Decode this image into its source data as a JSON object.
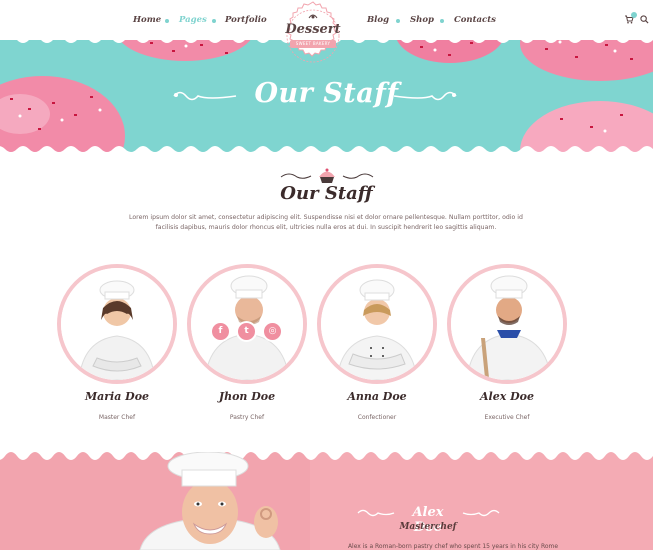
{
  "nav": {
    "items": [
      {
        "label": "Home",
        "active": false
      },
      {
        "label": "Pages",
        "active": true
      },
      {
        "label": "Portfolio",
        "active": false
      },
      {
        "label": "Blog",
        "active": false
      },
      {
        "label": "Shop",
        "active": false
      },
      {
        "label": "Contacts",
        "active": false
      }
    ],
    "logo": {
      "name": "Dessert",
      "tagline": "SWEET BAKERY"
    },
    "cart_icon": "cart-icon",
    "search_icon": "search-icon"
  },
  "hero": {
    "title": "Our Staff"
  },
  "staff": {
    "title": "Our Staff",
    "intro": "Lorem ipsum dolor sit amet, consectetur adipiscing elit. Suspendisse nisi et dolor ornare pellentesque. Nullam porttitor, odio id facilisis dapibus, mauris dolor rhoncus elit, ultricies nulla eros at dui. In suscipit hendrerit leo sagittis aliquam.",
    "members": [
      {
        "name": "Maria Doe",
        "role": "Master Chef"
      },
      {
        "name": "Jhon Doe",
        "role": "Pastry Chef"
      },
      {
        "name": "Anna Doe",
        "role": "Confectioner"
      },
      {
        "name": "Alex Doe",
        "role": "Executive Chef"
      }
    ],
    "social": [
      {
        "label": "f",
        "icon": "facebook-icon"
      },
      {
        "label": "t",
        "icon": "twitter-icon"
      },
      {
        "label": "◎",
        "icon": "instagram-icon"
      }
    ]
  },
  "feature": {
    "name": "Alex Doe",
    "role": "Masterchef",
    "text": "Alex is a Roman-born pastry chef who spent 15 years in his city Rome"
  },
  "colors": {
    "teal": "#7fd5d0",
    "pink": "#f2a4ae",
    "ring": "#f6c6cc",
    "dark": "#3b2b2b"
  }
}
